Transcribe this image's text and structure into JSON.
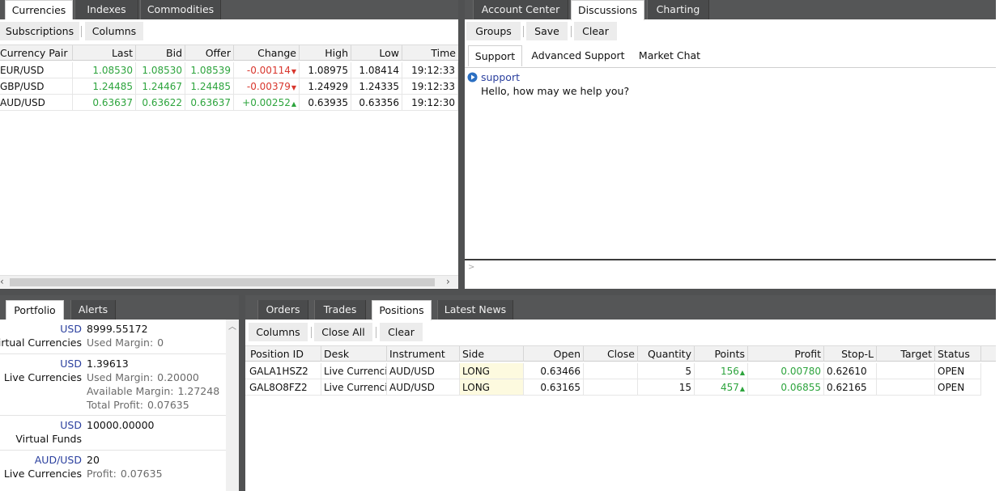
{
  "currencies_panel": {
    "tabs": [
      {
        "label": "Currencies",
        "active": true
      },
      {
        "label": "Indexes",
        "active": false
      },
      {
        "label": "Commodities",
        "active": false
      }
    ],
    "toolbar": {
      "subscriptions": "Subscriptions",
      "columns": "Columns"
    },
    "columns": [
      "Currency Pair",
      "Last",
      "Bid",
      "Offer",
      "Change",
      "High",
      "Low",
      "Time"
    ],
    "rows": [
      {
        "pair": "EUR/USD",
        "last": "1.08530",
        "bid": "1.08530",
        "offer": "1.08539",
        "change": "-0.00114",
        "dir": "down",
        "high": "1.08975",
        "low": "1.08414",
        "time": "19:12:33"
      },
      {
        "pair": "GBP/USD",
        "last": "1.24485",
        "bid": "1.24467",
        "offer": "1.24485",
        "change": "-0.00379",
        "dir": "down",
        "high": "1.24929",
        "low": "1.24335",
        "time": "19:12:33"
      },
      {
        "pair": "AUD/USD",
        "last": "0.63637",
        "bid": "0.63622",
        "offer": "0.63637",
        "change": "+0.00252",
        "dir": "up",
        "high": "0.63935",
        "low": "0.63356",
        "time": "19:12:30"
      }
    ],
    "scroll_left_icon": "chevron-left",
    "scroll_right_icon": "chevron-right"
  },
  "discussions_panel": {
    "tabs": [
      {
        "label": "Account Center",
        "active": false
      },
      {
        "label": "Discussions",
        "active": true
      },
      {
        "label": "Charting",
        "active": false
      }
    ],
    "toolbar": {
      "groups": "Groups",
      "save": "Save",
      "clear": "Clear"
    },
    "sub_tabs": [
      {
        "label": "Support",
        "active": true
      },
      {
        "label": "Advanced Support",
        "active": false
      },
      {
        "label": "Market Chat",
        "active": false
      }
    ],
    "message": {
      "sender": "support",
      "text": "Hello, how may we help you?",
      "icon": "play-circle"
    },
    "input_prompt": ">"
  },
  "portfolio_panel": {
    "tabs": [
      {
        "label": "Portfolio",
        "active": true
      },
      {
        "label": "Alerts",
        "active": false
      }
    ],
    "accounts": [
      {
        "currency": "USD",
        "name": "Virtual Currencies",
        "value": "8999.55172",
        "lines": [
          {
            "label": "Used Margin:",
            "value": "0"
          }
        ]
      },
      {
        "currency": "USD",
        "name": "Live Currencies",
        "value": "1.39613",
        "lines": [
          {
            "label": "Used Margin:",
            "value": "0.20000"
          },
          {
            "label": "Available Margin:",
            "value": "1.27248"
          },
          {
            "label": "Total Profit:",
            "value": "0.07635"
          }
        ]
      },
      {
        "currency": "USD",
        "name": "Virtual Funds",
        "value": "10000.00000",
        "lines": []
      },
      {
        "currency": "AUD/USD",
        "name": "Live Currencies",
        "value": "20",
        "lines": [
          {
            "label": "Profit:",
            "value": "0.07635"
          }
        ]
      }
    ]
  },
  "positions_panel": {
    "tabs": [
      {
        "label": "Orders",
        "active": false
      },
      {
        "label": "Trades",
        "active": false
      },
      {
        "label": "Positions",
        "active": true
      },
      {
        "label": "Latest News",
        "active": false
      }
    ],
    "toolbar": {
      "columns": "Columns",
      "close_all": "Close All",
      "clear": "Clear"
    },
    "columns": [
      "Position ID",
      "Desk",
      "Instrument",
      "Side",
      "Open",
      "Close",
      "Quantity",
      "Points",
      "Profit",
      "Stop-L",
      "Target",
      "Status"
    ],
    "rows": [
      {
        "id": "GALA1HSZ2",
        "desk": "Live Currencies",
        "instrument": "AUD/USD",
        "side": "LONG",
        "open": "0.63466",
        "close": "",
        "quantity": "5",
        "points": "156",
        "profit": "0.00780",
        "stop": "0.62610",
        "target": "",
        "status": "OPEN"
      },
      {
        "id": "GAL8O8FZ2",
        "desk": "Live Currencies",
        "instrument": "AUD/USD",
        "side": "LONG",
        "open": "0.63165",
        "close": "",
        "quantity": "15",
        "points": "457",
        "profit": "0.06855",
        "stop": "0.62165",
        "target": "",
        "status": "OPEN"
      }
    ]
  },
  "colors": {
    "up": "#2da43d",
    "down": "#d8362d",
    "tab_bar": "#555657",
    "side_highlight": "#fdfadf",
    "currency_label": "#2a3f9e"
  }
}
